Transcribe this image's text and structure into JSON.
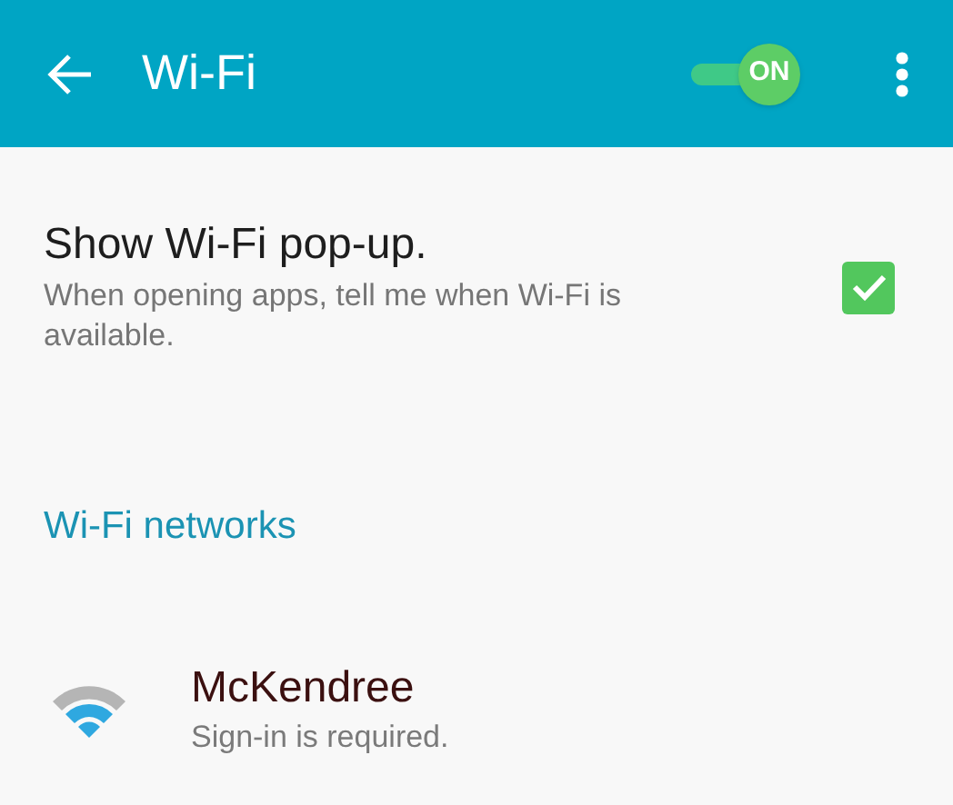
{
  "app_bar": {
    "title": "Wi-Fi",
    "switch": {
      "label": "ON",
      "on": true
    }
  },
  "popup_setting": {
    "title": "Show Wi-Fi pop-up.",
    "description": "When opening apps, tell me when Wi-Fi is available.",
    "checked": true
  },
  "section_title": "Wi-Fi networks",
  "networks": [
    {
      "name": "McKendree",
      "status": "Sign-in is required."
    }
  ]
}
